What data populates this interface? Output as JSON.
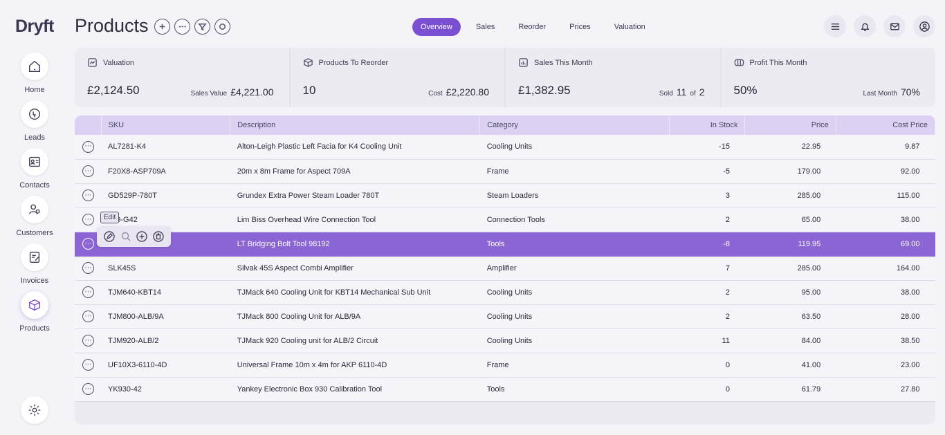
{
  "app": {
    "logo": "Dryft"
  },
  "page": {
    "title": "Products"
  },
  "sidebar": {
    "items": [
      {
        "label": "Home",
        "icon": "home-icon"
      },
      {
        "label": "Leads",
        "icon": "leads-icon"
      },
      {
        "label": "Contacts",
        "icon": "contacts-icon"
      },
      {
        "label": "Customers",
        "icon": "customers-icon"
      },
      {
        "label": "Invoices",
        "icon": "invoices-icon"
      },
      {
        "label": "Products",
        "icon": "box-icon",
        "active": true
      }
    ],
    "settings_icon": "gear-icon"
  },
  "title_actions": [
    "add-icon",
    "more-icon",
    "filter-icon",
    "search-icon"
  ],
  "tabs": [
    {
      "label": "Overview",
      "active": true
    },
    {
      "label": "Sales"
    },
    {
      "label": "Reorder"
    },
    {
      "label": "Prices"
    },
    {
      "label": "Valuation"
    }
  ],
  "top_icons": [
    "menu-icon",
    "bell-icon",
    "mail-icon",
    "user-icon"
  ],
  "stats": {
    "valuation": {
      "label": "Valuation",
      "value": "£2,124.50",
      "side_label": "Sales Value",
      "side_value": "£4,221.00"
    },
    "reorder": {
      "label": "Products To Reorder",
      "value": "10",
      "side_label": "Cost",
      "side_value": "£2,220.80"
    },
    "sales": {
      "label": "Sales This Month",
      "value": "£1,382.95",
      "side_label": "Sold",
      "sold": "11",
      "of_label": "of",
      "of_value": "2"
    },
    "profit": {
      "label": "Profit This Month",
      "value": "50%",
      "side_label": "Last Month",
      "side_value": "70%"
    }
  },
  "table": {
    "columns": [
      "SKU",
      "Description",
      "Category",
      "In Stock",
      "Price",
      "Cost Price"
    ],
    "rows": [
      {
        "sku": "AL7281-K4",
        "description": "Alton-Leigh Plastic Left Facia for K4 Cooling Unit",
        "category": "Cooling Units",
        "in_stock": "-15",
        "price": "22.95",
        "cost": "9.87"
      },
      {
        "sku": "F20X8-ASP709A",
        "description": "20m x 8m Frame for Aspect 709A",
        "category": "Frame",
        "in_stock": "-5",
        "price": "179.00",
        "cost": "92.00"
      },
      {
        "sku": "GD529P-780T",
        "description": "Grundex Extra Power Steam Loader 780T",
        "category": "Steam Loaders",
        "in_stock": "3",
        "price": "285.00",
        "cost": "115.00"
      },
      {
        "sku": "209-G42",
        "description": "Lim Biss Overhead Wire Connection Tool",
        "category": "Connection Tools",
        "in_stock": "2",
        "price": "65.00",
        "cost": "38.00"
      },
      {
        "sku": "",
        "description": "LT Bridging Bolt Tool 98192",
        "category": "Tools",
        "in_stock": "-8",
        "price": "119.95",
        "cost": "69.00",
        "selected": true
      },
      {
        "sku": "SLK45S",
        "description": "Silvak 45S Aspect Combi Amplifier",
        "category": "Amplifier",
        "in_stock": "7",
        "price": "285.00",
        "cost": "164.00"
      },
      {
        "sku": "TJM640-KBT14",
        "description": "TJMack 640 Cooling Unit for KBT14 Mechanical Sub Unit",
        "category": "Cooling Units",
        "in_stock": "2",
        "price": "95.00",
        "cost": "38.00"
      },
      {
        "sku": "TJM800-ALB/9A",
        "description": "TJMack 800 Cooling Unit for ALB/9A",
        "category": "Cooling Units",
        "in_stock": "2",
        "price": "63.50",
        "cost": "28.00"
      },
      {
        "sku": "TJM920-ALB/2",
        "description": "TJMack 920 Cooling unit for ALB/2 Circuit",
        "category": "Cooling Units",
        "in_stock": "11",
        "price": "84.00",
        "cost": "38.50"
      },
      {
        "sku": "UF10X3-6110-4D",
        "description": "Universal Frame 10m x 4m for AKP 6110-4D",
        "category": "Frame",
        "in_stock": "0",
        "price": "41.00",
        "cost": "23.00"
      },
      {
        "sku": "YK930-42",
        "description": "Yankey Electronic Box 930 Calibration Tool",
        "category": "Tools",
        "in_stock": "0",
        "price": "61.79",
        "cost": "27.80"
      }
    ]
  },
  "row_actions": {
    "tooltip": "Edit",
    "icons": [
      "edit-icon",
      "search-icon",
      "add-icon",
      "delete-icon"
    ]
  },
  "colors": {
    "accent": "#7b4fd1",
    "selected_row": "#8c65d4",
    "header": "#dcd1f3"
  }
}
